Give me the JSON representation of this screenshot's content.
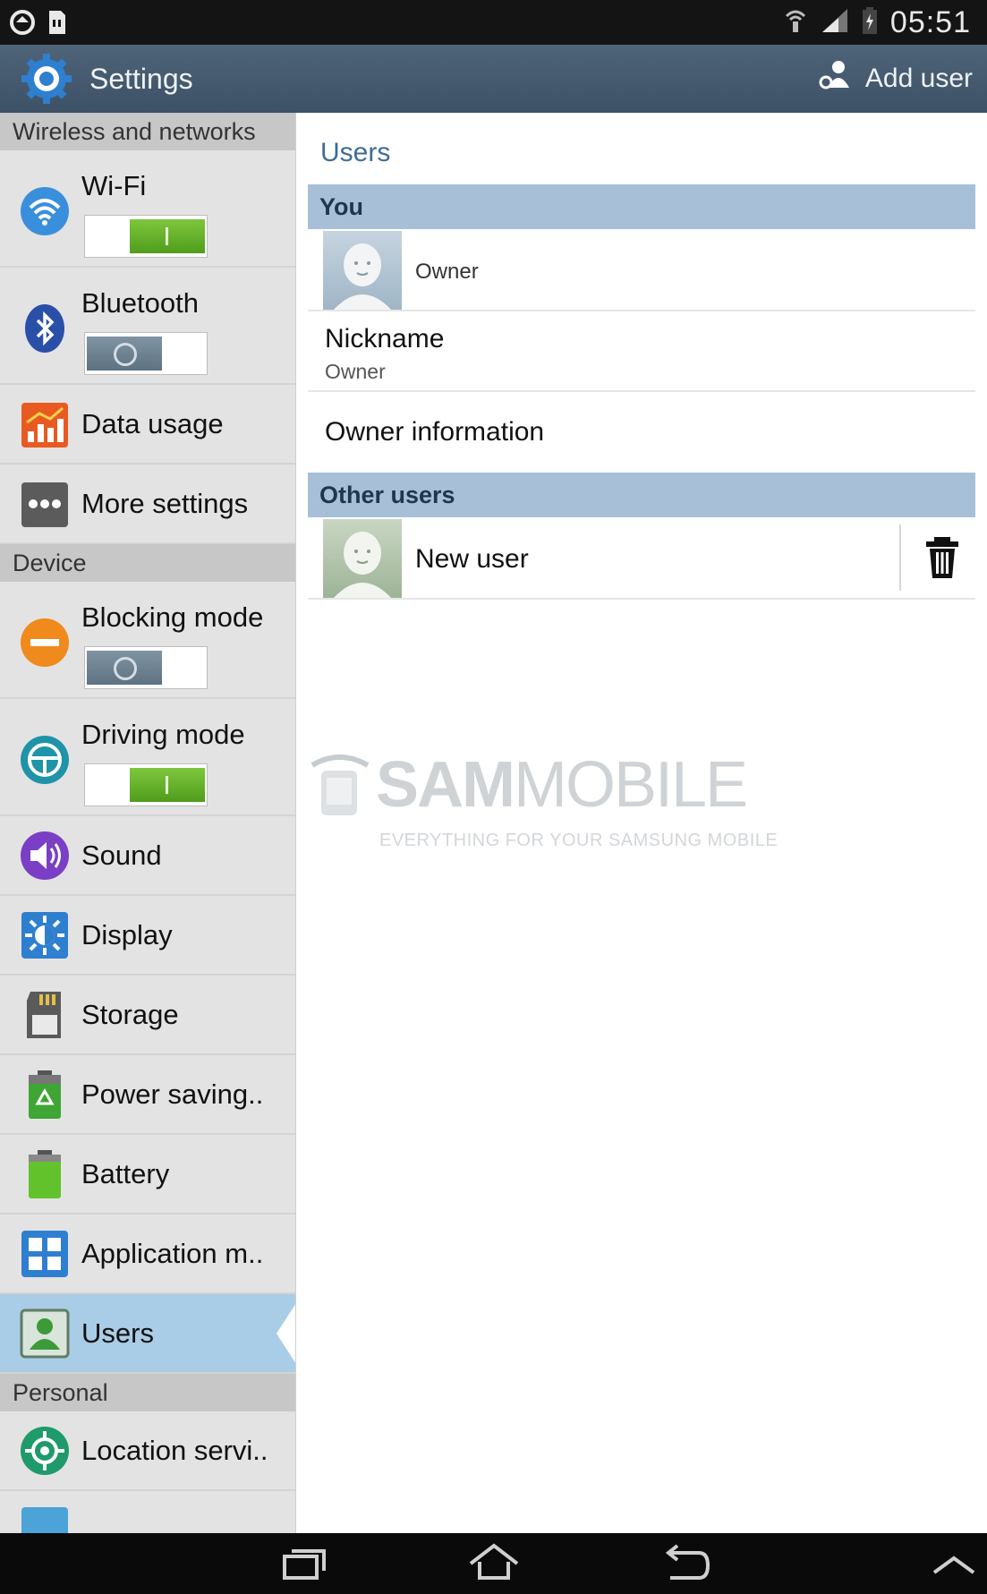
{
  "status_bar": {
    "time": "05:51"
  },
  "action_bar": {
    "title": "Settings",
    "add_user_label": "Add user"
  },
  "sidebar": {
    "sections": [
      {
        "header": "Wireless and networks"
      },
      {
        "header": "Device"
      },
      {
        "header": "Personal"
      }
    ],
    "items": [
      {
        "label": "Wi-Fi",
        "icon": "wifi-icon",
        "toggle": "on"
      },
      {
        "label": "Bluetooth",
        "icon": "bluetooth-icon",
        "toggle": "off"
      },
      {
        "label": "Data usage",
        "icon": "data-usage-icon"
      },
      {
        "label": "More settings",
        "icon": "more-icon"
      },
      {
        "label": "Blocking mode",
        "icon": "blocking-icon",
        "toggle": "off"
      },
      {
        "label": "Driving mode",
        "icon": "driving-icon",
        "toggle": "on"
      },
      {
        "label": "Sound",
        "icon": "sound-icon"
      },
      {
        "label": "Display",
        "icon": "display-icon"
      },
      {
        "label": "Storage",
        "icon": "storage-icon"
      },
      {
        "label": "Power saving..",
        "icon": "power-saving-icon"
      },
      {
        "label": "Battery",
        "icon": "battery-icon"
      },
      {
        "label": "Application m..",
        "icon": "apps-icon"
      },
      {
        "label": "Users",
        "icon": "users-icon",
        "selected": true
      },
      {
        "label": "Location servi..",
        "icon": "location-icon"
      }
    ]
  },
  "main": {
    "title": "Users",
    "you_header": "You",
    "owner_label": "Owner",
    "nickname_title": "Nickname",
    "nickname_value": "Owner",
    "owner_info": "Owner information",
    "other_users_header": "Other users",
    "new_user_label": "New user"
  },
  "watermark": {
    "name_bold": "SAM",
    "name_light": "MOBILE",
    "tagline": "EVERYTHING FOR YOUR SAMSUNG MOBILE"
  },
  "colors": {
    "action_bar": "#465b70",
    "section_header": "#a7c0d8",
    "selected": "#a9cde7",
    "toggle_on": "#6ab52f"
  }
}
